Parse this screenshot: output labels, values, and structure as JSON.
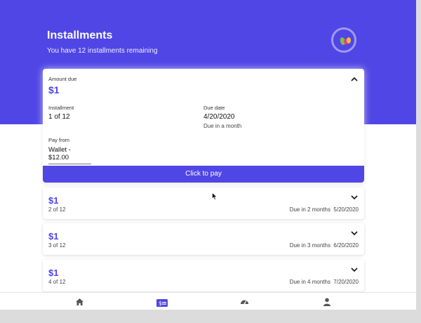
{
  "header": {
    "title": "Installments",
    "subtitle": "You have 12 installments remaining"
  },
  "current": {
    "amount_due_label": "Amount due",
    "amount": "$1",
    "installment_label": "Installment",
    "installment_value": "1 of 12",
    "due_date_label": "Due date",
    "due_date_value": "4/20/2020",
    "due_relative": "Due in a month",
    "pay_from_label": "Pay from",
    "pay_from_value": "Wallet - $12.00",
    "pay_button_label": "Click to pay"
  },
  "installments": [
    {
      "amount": "$1",
      "index": "2 of 12",
      "due_relative": "Due in 2 months",
      "due_date": "5/20/2020"
    },
    {
      "amount": "$1",
      "index": "3 of 12",
      "due_relative": "Due in 3 months",
      "due_date": "6/20/2020"
    },
    {
      "amount": "$1",
      "index": "4 of 12",
      "due_relative": "Due in 4 months",
      "due_date": "7/20/2020"
    }
  ],
  "nav": {
    "items": [
      {
        "icon": "home-icon"
      },
      {
        "icon": "payment-card-icon",
        "active": true,
        "label": "$"
      },
      {
        "icon": "dashboard-gauge-icon"
      },
      {
        "icon": "user-icon"
      }
    ]
  },
  "colors": {
    "accent": "#4f46e5",
    "nav_inactive": "#555555"
  }
}
